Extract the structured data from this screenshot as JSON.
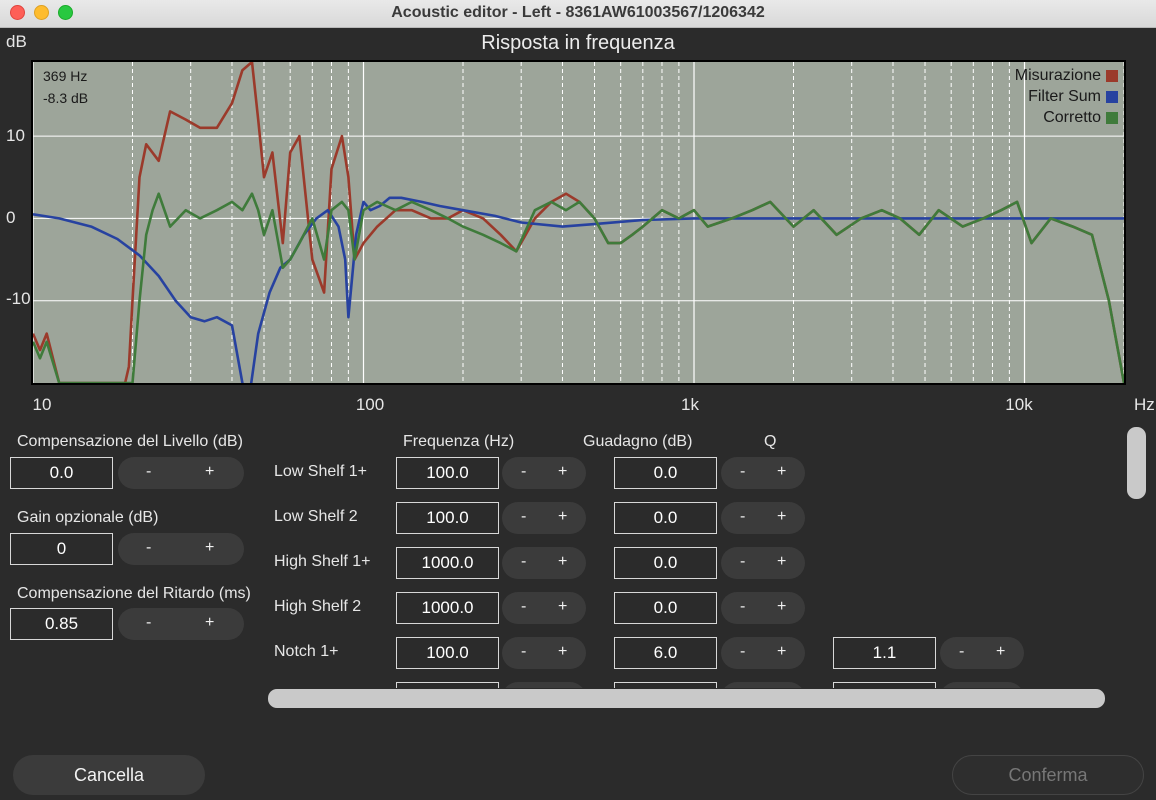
{
  "window": {
    "title": "Acoustic editor - Left - 8361AW61003567/1206342"
  },
  "chart": {
    "title": "Risposta in frequenza",
    "y_unit": "dB",
    "x_unit": "Hz",
    "y_ticks": [
      "10",
      "0",
      "-10"
    ],
    "x_ticks": [
      "10",
      "100",
      "1k",
      "10k"
    ],
    "cursor": {
      "freq": "369 Hz",
      "level": "-8.3 dB"
    },
    "legend": [
      {
        "label": "Misurazione",
        "color": "#9b3a2b"
      },
      {
        "label": "Filter Sum",
        "color": "#2742a0"
      },
      {
        "label": "Corretto",
        "color": "#3f7b3b"
      }
    ]
  },
  "chart_data": {
    "type": "line",
    "title": "Risposta in frequenza",
    "xlabel": "Hz",
    "ylabel": "dB",
    "xscale": "log",
    "xlim": [
      10,
      20000
    ],
    "ylim": [
      -20,
      19
    ],
    "grid": true,
    "legend_position": "top-right",
    "series": [
      {
        "name": "Misurazione",
        "color": "#9b3a2b",
        "x": [
          10,
          10.5,
          11,
          12,
          19,
          19.5,
          20,
          21,
          22,
          24,
          26,
          29,
          32,
          36,
          40,
          43,
          46,
          48,
          50,
          53,
          57,
          60,
          64,
          70,
          76,
          80,
          86,
          90,
          94,
          100,
          110,
          125,
          140,
          160,
          180,
          200,
          230,
          260,
          290,
          330,
          370,
          410,
          450,
          500,
          550,
          600,
          650,
          700,
          800,
          900,
          1000,
          1100,
          1300,
          1500,
          1700,
          2000,
          2300,
          2700,
          3200,
          3700,
          4200,
          4800,
          5500,
          6500,
          7500,
          8500,
          9500,
          10500,
          12000,
          14000,
          16000,
          18000,
          20000
        ],
        "y": [
          -14,
          -16,
          -14,
          -20,
          -20,
          -18,
          -10,
          5,
          9,
          7,
          13,
          12,
          11,
          11,
          14,
          18,
          19,
          12,
          5,
          8,
          -3,
          8,
          10,
          -5,
          -9,
          6,
          10,
          5,
          -5,
          -3,
          -1,
          1,
          1,
          0,
          0,
          1,
          0,
          -2,
          -4,
          0,
          2,
          3,
          2,
          0,
          -3,
          -3,
          -2,
          -1,
          1,
          0,
          1,
          -1,
          0,
          1,
          2,
          -1,
          1,
          -2,
          0,
          1,
          0,
          -2,
          1,
          -1,
          0,
          1,
          2,
          -3,
          0,
          -1,
          -2,
          -10,
          -20
        ]
      },
      {
        "name": "Filter Sum",
        "color": "#2742a0",
        "x": [
          10,
          12,
          15,
          18,
          21,
          24,
          27,
          30,
          33,
          36,
          40,
          43,
          45,
          48,
          52,
          56,
          60,
          66,
          72,
          78,
          84,
          88,
          90,
          92,
          95,
          100,
          105,
          112,
          120,
          130,
          150,
          170,
          200,
          250,
          300,
          400,
          500,
          700,
          1000,
          2000,
          5000,
          10000,
          20000
        ],
        "y": [
          0.5,
          0,
          -1,
          -2.5,
          -4.5,
          -7,
          -10,
          -12,
          -12.5,
          -12,
          -13,
          -20,
          -22,
          -14,
          -9,
          -6,
          -5,
          -2,
          0,
          1,
          -1,
          -5,
          -12,
          -8,
          -2,
          2,
          1,
          1.5,
          2.5,
          2.5,
          2,
          1.5,
          1,
          0.3,
          -0.5,
          -1,
          -0.7,
          -0.2,
          0,
          0,
          0,
          0,
          0
        ]
      },
      {
        "name": "Corretto",
        "color": "#3f7b3b",
        "x": [
          10,
          10.5,
          11,
          12,
          20,
          21,
          22,
          23,
          24,
          26,
          29,
          32,
          36,
          40,
          43,
          46,
          48,
          50,
          53,
          57,
          60,
          64,
          70,
          76,
          80,
          86,
          90,
          94,
          100,
          110,
          125,
          140,
          160,
          180,
          200,
          230,
          260,
          290,
          330,
          370,
          410,
          450,
          500,
          550,
          600,
          650,
          700,
          800,
          900,
          1000,
          1100,
          1300,
          1500,
          1700,
          2000,
          2300,
          2700,
          3200,
          3700,
          4200,
          4800,
          5500,
          6500,
          7500,
          8500,
          9500,
          10500,
          12000,
          14000,
          16000,
          18000,
          20000
        ],
        "y": [
          -15,
          -17,
          -15,
          -20,
          -20,
          -10,
          -2,
          1,
          3,
          -1,
          1,
          0,
          1,
          2,
          1,
          3,
          1,
          -2,
          1,
          -6,
          -5,
          -3,
          0,
          -5,
          1,
          2,
          1,
          -5,
          1,
          2,
          1,
          2,
          1,
          0,
          -1,
          -2,
          -3,
          -4,
          1,
          2,
          1,
          2,
          0,
          -3,
          -3,
          -2,
          -1,
          1,
          0,
          1,
          -1,
          0,
          1,
          2,
          -1,
          1,
          -2,
          0,
          1,
          0,
          -2,
          1,
          -1,
          0,
          1,
          2,
          -3,
          0,
          -1,
          -2,
          -10,
          -20
        ]
      }
    ]
  },
  "left_panel": {
    "level_comp": {
      "label": "Compensazione del Livello (dB)",
      "value": "0.0"
    },
    "optional_gain": {
      "label": "Gain opzionale (dB)",
      "value": "0"
    },
    "delay_comp": {
      "label": "Compensazione del Ritardo (ms)",
      "value": "0.85"
    }
  },
  "stepper": {
    "minus": "-",
    "plus": "+"
  },
  "filters": {
    "headers": {
      "frequency": "Frequenza (Hz)",
      "gain": "Guadagno (dB)",
      "q": "Q"
    },
    "rows": [
      {
        "name": "Low Shelf 1+",
        "freq": "100.0",
        "gain": "0.0"
      },
      {
        "name": "Low Shelf 2",
        "freq": "100.0",
        "gain": "0.0"
      },
      {
        "name": "High Shelf 1+",
        "freq": "1000.0",
        "gain": "0.0"
      },
      {
        "name": "High Shelf 2",
        "freq": "1000.0",
        "gain": "0.0"
      },
      {
        "name": "Notch 1+",
        "freq": "100.0",
        "gain": "6.0",
        "q": "1.1"
      }
    ]
  },
  "footer": {
    "cancel": "Cancella",
    "confirm": "Conferma"
  }
}
